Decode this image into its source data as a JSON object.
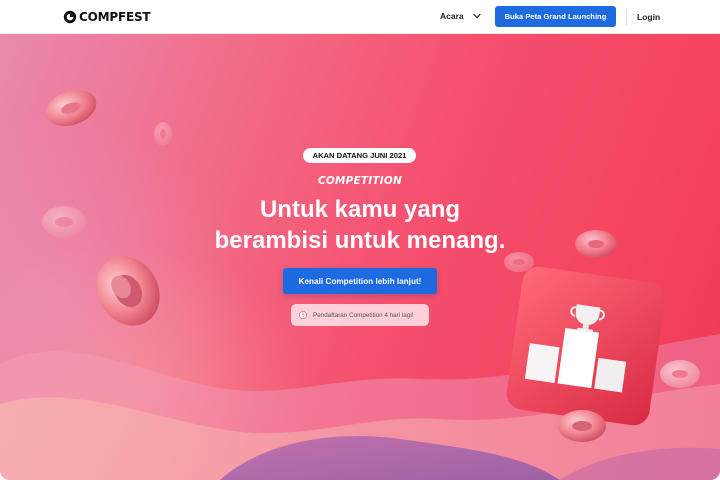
{
  "navbar": {
    "logo_text": "COMPFEST",
    "menu_acara": "Acara",
    "btn_peta": "Buka Peta Grand Launching",
    "login": "Login"
  },
  "hero": {
    "badge": "AKAN DATANG JUNI 2021",
    "eyebrow": "COMPETITION",
    "headline_line1": "Untuk kamu yang",
    "headline_line2": "berambisi untuk menang.",
    "cta": "Kenali Competition lebih lanjut!",
    "notice": "Pendaftaran Competition 4 hari lagi!"
  },
  "colors": {
    "primary_blue": "#1e6ae0",
    "hero_pink": "#f26a86",
    "hero_red": "#f23a55",
    "trophy_box": "#e83a4e"
  },
  "icons": [
    "logo-mark-icon",
    "chevron-down-icon",
    "info-icon",
    "trophy-icon",
    "donut-icon"
  ]
}
